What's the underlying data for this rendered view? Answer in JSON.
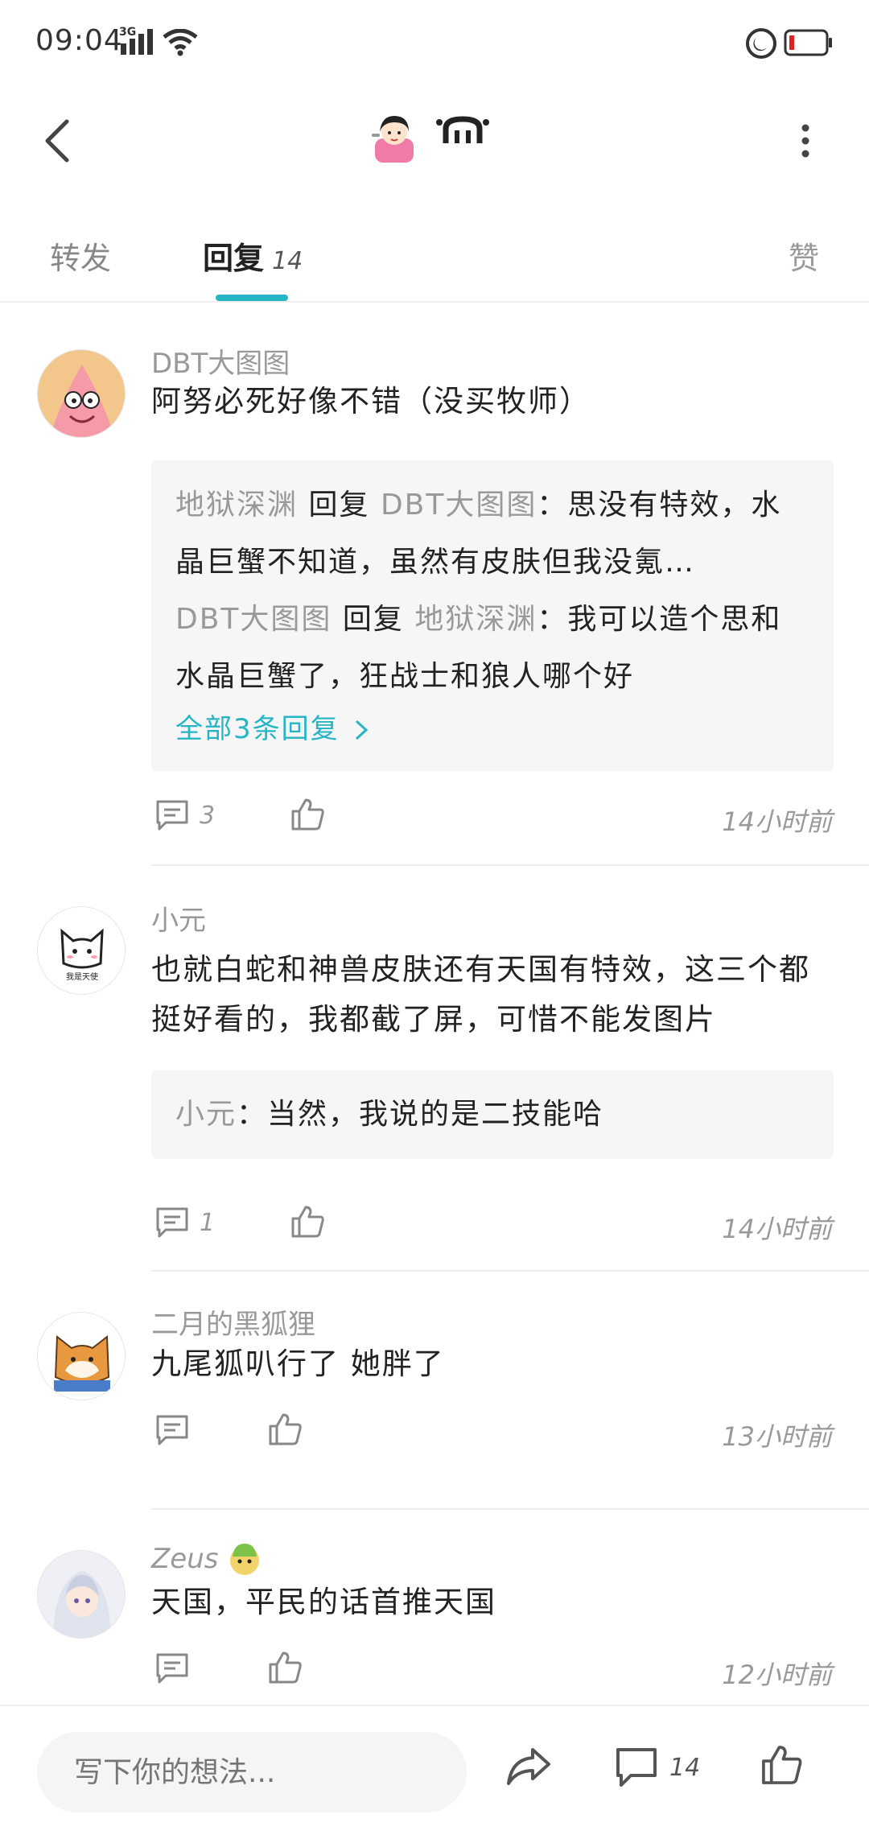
{
  "status_bar": {
    "time": "09:04",
    "network": "3G"
  },
  "header": {
    "avatar_icon": "cartoon-girl-avatar",
    "nickname_icon": "stylized-nickname-glyph"
  },
  "tabs": {
    "repost": "转发",
    "reply": "回复",
    "reply_count": "14",
    "like": "赞",
    "accent": "#25b5c4"
  },
  "comments": [
    {
      "author": "DBT大图图",
      "text": "阿努必死好像不错（没买牧师）",
      "replies": [
        {
          "nick": "地狱深渊",
          "verb": "回复",
          "target": "DBT大图图",
          "text": "：思没有特效，水晶巨蟹不知道，虽然有皮肤但我没氪…"
        },
        {
          "nick": "DBT大图图",
          "verb": "回复",
          "target": "地狱深渊",
          "text": "：我可以造个思和水晶巨蟹了，狂战士和狼人哪个好"
        }
      ],
      "all_replies": "全部3条回复",
      "comment_count": "3",
      "time": "14小时前"
    },
    {
      "author": "小元",
      "text": "也就白蛇和神兽皮肤还有天国有特效，这三个都挺好看的，我都截了屏，可惜不能发图片",
      "replies": [
        {
          "nick": "小元",
          "text": "：当然，我说的是二技能哈"
        }
      ],
      "comment_count": "1",
      "time": "14小时前",
      "avatar_caption": "我是天使"
    },
    {
      "author": "二月的黑狐狸",
      "text": "九尾狐叭行了 她胖了",
      "comment_count": "",
      "time": "13小时前"
    },
    {
      "author": "Zeus",
      "text": "天国，平民的话首推天国",
      "comment_count": "",
      "time": "12小时前"
    }
  ],
  "bottom_bar": {
    "input_placeholder": "写下你的想法...",
    "comment_count": "14"
  }
}
